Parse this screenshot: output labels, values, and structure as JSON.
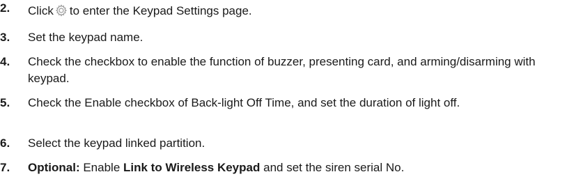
{
  "steps": [
    {
      "number": "2.",
      "text_before_icon": "Click",
      "icon": "gear-settings-icon",
      "text_after_icon": "to enter the Keypad Settings page."
    },
    {
      "number": "3.",
      "text": "Set the keypad name."
    },
    {
      "number": "4.",
      "text": "Check the checkbox to enable the function of buzzer, presenting card, and arming/disarming with keypad."
    },
    {
      "number": "5.",
      "text": "Check the Enable checkbox of Back-light Off Time, and set the duration of light off."
    },
    {
      "number": "6.",
      "text": "Select the keypad linked partition."
    },
    {
      "number": "7.",
      "bold_prefix": "Optional:",
      "text_middle": "Enable",
      "bold_term": "Link to Wireless Keypad",
      "text_end": "and set the siren serial No."
    }
  ],
  "colors": {
    "text": "#1a1a1a",
    "icon": "#9a9a9a"
  }
}
